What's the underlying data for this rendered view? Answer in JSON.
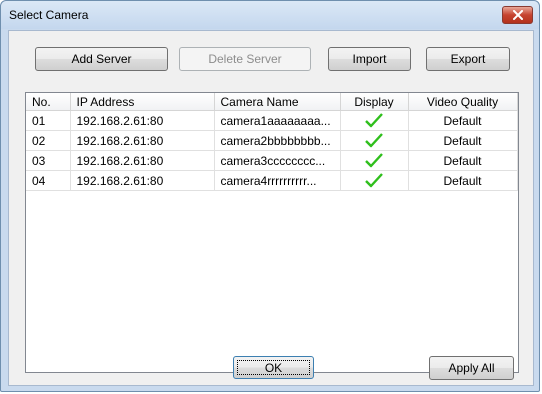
{
  "window": {
    "title": "Select Camera"
  },
  "toolbar": {
    "add_server": "Add Server",
    "delete_server": "Delete Server",
    "import": "Import",
    "export": "Export"
  },
  "table": {
    "columns": [
      "No.",
      "IP Address",
      "Camera Name",
      "Display",
      "Video Quality"
    ],
    "rows": [
      {
        "no": "01",
        "ip": "192.168.2.61:80",
        "name": "camera1aaaaaaaa...",
        "display": true,
        "quality": "Default"
      },
      {
        "no": "02",
        "ip": "192.168.2.61:80",
        "name": "camera2bbbbbbbb...",
        "display": true,
        "quality": "Default"
      },
      {
        "no": "03",
        "ip": "192.168.2.61:80",
        "name": "camera3cccccccc...",
        "display": true,
        "quality": "Default"
      },
      {
        "no": "04",
        "ip": "192.168.2.61:80",
        "name": "camera4rrrrrrrrrr...",
        "display": true,
        "quality": "Default"
      }
    ]
  },
  "footer": {
    "ok": "OK",
    "apply_all": "Apply All"
  },
  "colors": {
    "checkmark": "#2fbf1c",
    "close_button": "#c6432f"
  },
  "icons": {
    "close": "close-icon",
    "display": "check-icon"
  }
}
